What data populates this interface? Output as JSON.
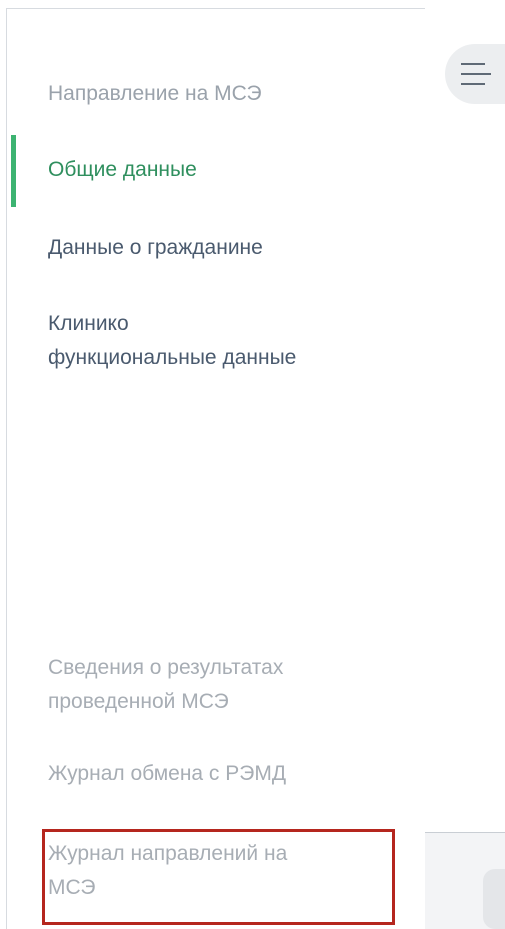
{
  "sidebar": {
    "section_title": "Направление на МСЭ",
    "items": [
      {
        "label": "Общие данные",
        "state": "active"
      },
      {
        "label": "Данные о гражданине",
        "state": "normal"
      },
      {
        "label_line1": "Клинико",
        "label_line2": "функциональные данные",
        "state": "normal"
      }
    ],
    "bottom_items": [
      {
        "label_line1": "Сведения о результатах",
        "label_line2": "проведенной МСЭ",
        "state": "disabled"
      },
      {
        "label": "Журнал обмена с РЭМД",
        "state": "disabled"
      },
      {
        "label_line1": "Журнал направлений на",
        "label_line2": "МСЭ",
        "state": "disabled",
        "highlighted": true
      }
    ]
  },
  "toolbar": {
    "menu_icon": "menu-icon"
  },
  "colors": {
    "active_text": "#2f8f5e",
    "active_bar": "#3cb371",
    "normal_text": "#4a5a6e",
    "muted_text": "#a7adb4",
    "highlight_border": "#b5261e"
  }
}
